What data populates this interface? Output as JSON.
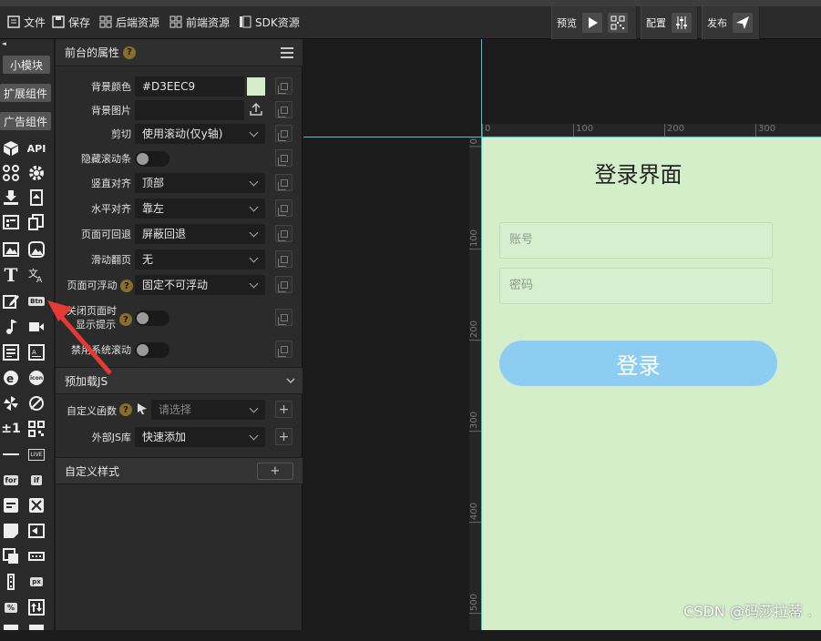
{
  "menu": {
    "file": "文件",
    "save": "保存",
    "backend": "后端资源",
    "frontend": "前端资源",
    "sdk": "SDK资源"
  },
  "toolbar": {
    "preview": "预览",
    "config": "配置",
    "publish": "发布"
  },
  "sidebar": {
    "btn_small": "小模块",
    "btn_ext": "扩展组件",
    "btn_ad": "广告组件",
    "api": "API",
    "btn_icon_label": "Btn",
    "for_label": "for",
    "if_label": "if",
    "px_label": "px",
    "pct_label": "%",
    "plusminus": "±1",
    "live_label": "LIVE",
    "icon_label": "icon"
  },
  "props": {
    "title": "前台的属性",
    "bgcolor_label": "背景颜色",
    "bgcolor_value": "#D3EEC9",
    "bgimage_label": "背景图片",
    "clip_label": "剪切",
    "clip_value": "使用滚动(仅y轴)",
    "hide_scroll_label": "隐藏滚动条",
    "valign_label": "竖直对齐",
    "valign_value": "顶部",
    "halign_label": "水平对齐",
    "halign_value": "靠左",
    "back_label": "页面可回退",
    "back_value": "屏蔽回退",
    "swipe_label": "滑动翻页",
    "swipe_value": "无",
    "float_label": "页面可浮动",
    "float_value": "固定不可浮动",
    "close_hint_label1": "关闭页面时",
    "close_hint_label2": "显示提示",
    "disable_scroll_label": "禁用系统滚动",
    "preload_title": "预加载JS",
    "custom_func_label": "自定义函数",
    "custom_func_placeholder": "请选择",
    "ext_js_label": "外部JS库",
    "ext_js_value": "快速添加",
    "custom_style_title": "自定义样式",
    "add": "+"
  },
  "canvas": {
    "ruler_top": [
      "0",
      "100",
      "200",
      "300"
    ],
    "ruler_left": [
      "0",
      "100",
      "200",
      "300",
      "400",
      "500"
    ],
    "login_title": "登录界面",
    "account_placeholder": "账号",
    "password_placeholder": "密码",
    "login_button": "登录",
    "watermark": "CSDN @码莎拉蒂 ."
  },
  "colors": {
    "page_bg": "#D3EEC9",
    "button": "#8dcdf2",
    "guide": "#49c6d6",
    "arrow": "#e53935"
  }
}
